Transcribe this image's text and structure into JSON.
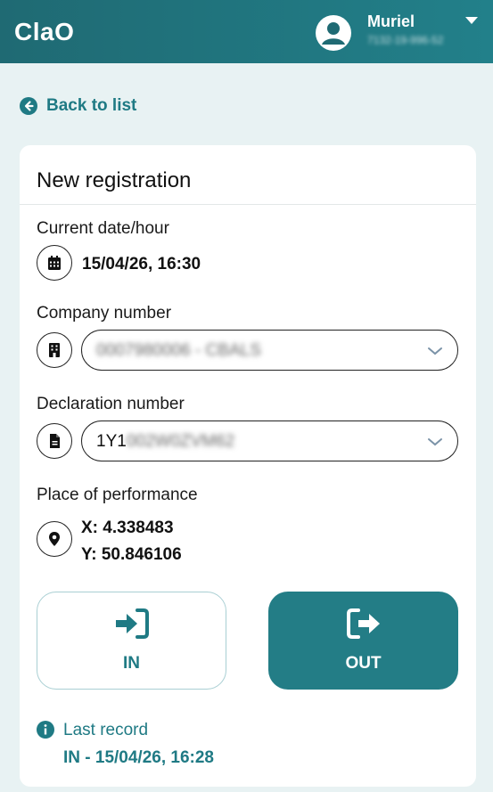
{
  "header": {
    "brand": "ClaO",
    "user_name": "Muriel",
    "user_sub": "7132-19-996-52"
  },
  "back_link": "Back to list",
  "form": {
    "title": "New registration",
    "datetime": {
      "label": "Current date/hour",
      "value": "15/04/26, 16:30"
    },
    "company": {
      "label": "Company number",
      "value": "0007980006 - CBALS"
    },
    "declaration": {
      "label": "Declaration number",
      "value_prefix": "1Y1",
      "value_rest": "002W0ZVM62"
    },
    "place": {
      "label": "Place of performance",
      "x": "X: 4.338483",
      "y": "Y: 50.846106"
    },
    "btn_in": "IN",
    "btn_out": "OUT",
    "last_record": {
      "label": "Last record",
      "value": "IN - 15/04/26, 16:28"
    }
  },
  "colors": {
    "accent": "#1f7a84",
    "header": "#22808a",
    "background": "#e8f2f3"
  },
  "icons": {
    "user": "user-circle-icon",
    "back": "arrow-left-circle-icon",
    "calendar": "calendar-icon",
    "building": "building-icon",
    "document": "document-icon",
    "location": "map-pin-icon",
    "sign_in": "sign-in-icon",
    "sign_out": "sign-out-icon",
    "info": "info-icon"
  }
}
